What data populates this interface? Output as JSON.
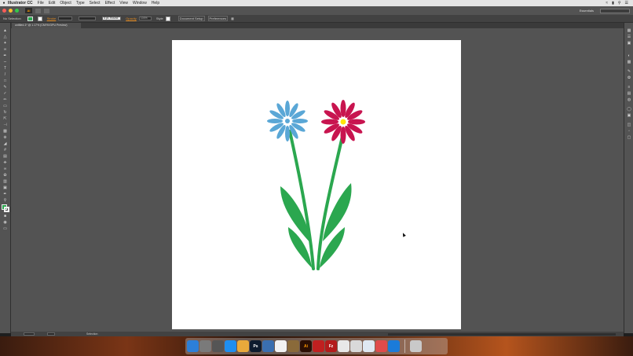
{
  "menubar": {
    "app_name": "Illustrator CC",
    "items": [
      "File",
      "Edit",
      "Object",
      "Type",
      "Select",
      "Effect",
      "View",
      "Window",
      "Help"
    ]
  },
  "titlebar": {
    "logo": "Ai",
    "workspace": "Essentials",
    "search_placeholder": ""
  },
  "controlbar": {
    "selection_label": "No Selection",
    "stroke_label": "Stroke",
    "opacity_label": "Opacity",
    "style_label": "Style",
    "doc_setup": "Document Setup",
    "preferences": "Preferences",
    "brush_value": "5 pt. Round",
    "opacity_value": "100%"
  },
  "document_tab": {
    "label": "untitled-1* @ 1.17% (CMYK/GPU Preview)"
  },
  "toolbar": {
    "tools": [
      "selection",
      "direct-selection",
      "magic-wand",
      "lasso",
      "pen",
      "curvature",
      "type",
      "line",
      "rectangle",
      "paintbrush",
      "shaper",
      "pencil",
      "eraser",
      "rotate",
      "scale",
      "width",
      "free-transform",
      "shape-builder",
      "perspective",
      "mesh",
      "gradient",
      "eyedropper",
      "blend",
      "symbol-sprayer",
      "column-graph",
      "artboard",
      "slice",
      "hand",
      "zoom"
    ],
    "fill_color": "#2ba74f",
    "stroke_color": "#eeeeee"
  },
  "artwork": {
    "flower_left_color": "#5aa7d6",
    "flower_right_color": "#c8144f",
    "flower_right_center": "#ffe60a",
    "stem_color": "#2ba74f"
  },
  "statusbar": {
    "zoom": "",
    "page": "",
    "status": "Selection"
  },
  "dock": {
    "apps": [
      {
        "name": "Finder",
        "color": "#2c7fd9",
        "label": ""
      },
      {
        "name": "System Preferences",
        "color": "#7a7a7a",
        "label": ""
      },
      {
        "name": "Launchpad",
        "color": "#555555",
        "label": ""
      },
      {
        "name": "App Store",
        "color": "#1e8ef0",
        "label": ""
      },
      {
        "name": "Photos",
        "color": "#e9a93b",
        "label": ""
      },
      {
        "name": "Photoshop",
        "color": "#0d1b2e",
        "label": "Ps"
      },
      {
        "name": "Preview",
        "color": "#3a6fb0",
        "label": ""
      },
      {
        "name": "Calendar",
        "color": "#f2f2f2",
        "label": ""
      },
      {
        "name": "Keynote",
        "color": "#8a6a3a",
        "label": ""
      },
      {
        "name": "Illustrator",
        "color": "#2b0f04",
        "label": "Ai"
      },
      {
        "name": "Autodesk",
        "color": "#c02020",
        "label": ""
      },
      {
        "name": "FileZilla",
        "color": "#b31b1b",
        "label": "Fz"
      },
      {
        "name": "iTunes",
        "color": "#e8e8e8",
        "label": ""
      },
      {
        "name": "Chrome",
        "color": "#d9d9d9",
        "label": ""
      },
      {
        "name": "Safari",
        "color": "#dfe8f2",
        "label": ""
      },
      {
        "name": "Skype",
        "color": "#e04b4b",
        "label": ""
      },
      {
        "name": "Screenshot",
        "color": "#1b7bd9",
        "label": ""
      },
      {
        "name": "Trash",
        "color": "#c9c9c9",
        "label": ""
      }
    ]
  }
}
